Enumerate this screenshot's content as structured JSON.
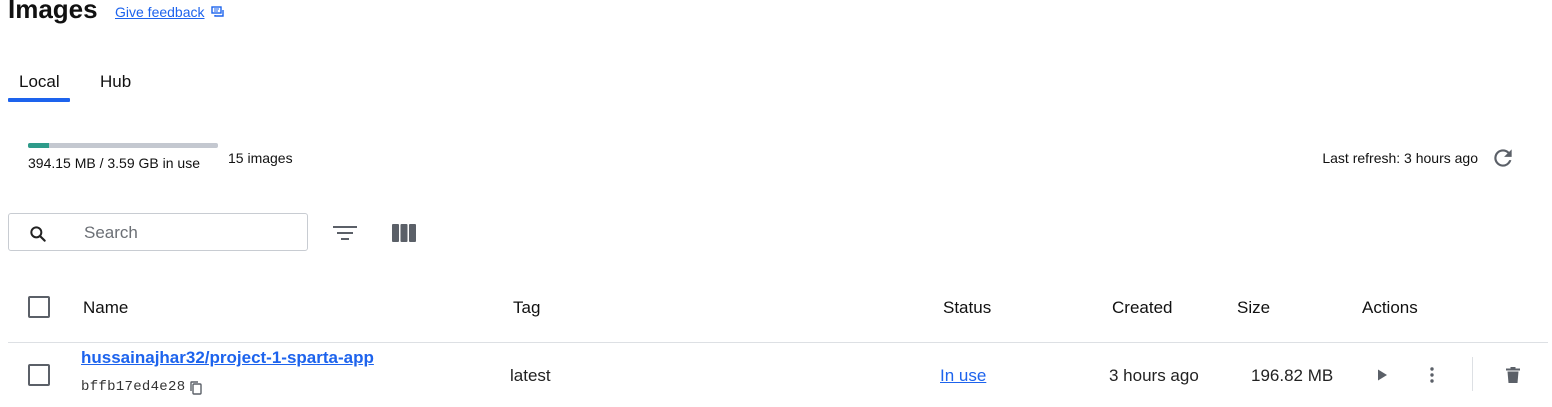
{
  "header": {
    "title": "Images",
    "feedback_label": "Give feedback",
    "feedback_icon": "feedback-icon"
  },
  "tabs": [
    {
      "label": "Local",
      "active": true
    },
    {
      "label": "Hub",
      "active": false
    }
  ],
  "storage": {
    "usage_text": "394.15 MB / 3.59 GB in use",
    "used_fraction": 0.11,
    "count_text": "15 images",
    "bar_fill_color": "#2e9b8a",
    "bar_track_color": "#c4c8d0"
  },
  "refresh": {
    "text": "Last refresh: 3 hours ago",
    "icon": "refresh-icon"
  },
  "toolbar": {
    "search_placeholder": "Search",
    "search_icon": "search-icon",
    "filter_icon": "filter-icon",
    "columns_icon": "columns-icon"
  },
  "table": {
    "columns": [
      "Name",
      "Tag",
      "Status",
      "Created",
      "Size",
      "Actions"
    ],
    "rows": [
      {
        "name": "hussainajhar32/project-1-sparta-app",
        "id": "bffb17ed4e28",
        "tag": "latest",
        "status": "In use",
        "created": "3 hours ago",
        "size": "196.82 MB"
      }
    ]
  },
  "colors": {
    "accent": "#1d63ed"
  }
}
